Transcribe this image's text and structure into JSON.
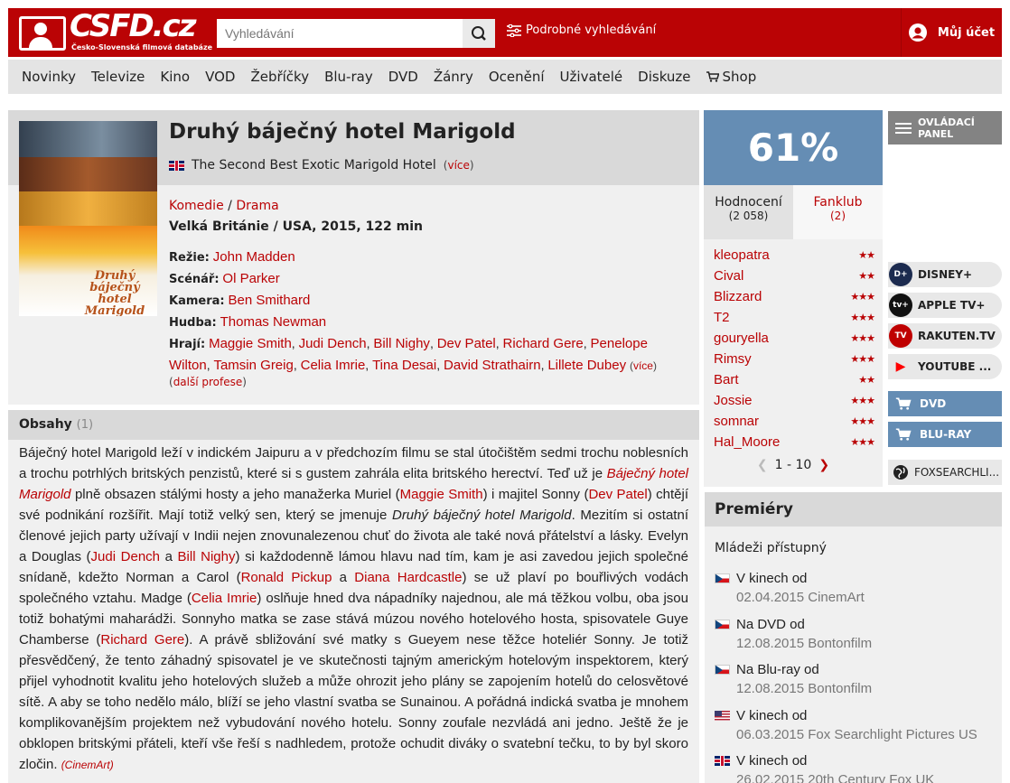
{
  "header": {
    "logo_text": "CSFD.cz",
    "logo_sub": "Česko-Slovenská filmová databáze",
    "search_placeholder": "Vyhledávání",
    "advanced_search": "Podrobné vyhledávání",
    "account": "Můj účet"
  },
  "nav": {
    "items": [
      "Novinky",
      "Televize",
      "Kino",
      "VOD",
      "Žebříčky",
      "Blu-ray",
      "DVD",
      "Žánry",
      "Ocenění",
      "Uživatelé",
      "Diskuze",
      "Shop"
    ]
  },
  "film": {
    "title": "Druhý báječný hotel Marigold",
    "original_title": "The Second Best Exotic Marigold Hotel",
    "more_label": "více",
    "genres": [
      "Komedie",
      "Drama"
    ],
    "origin": "Velká Británie / USA, 2015, 122 min",
    "poster_title": "Druhý báječný hotel Marigold",
    "creators": {
      "directing_label": "Režie:",
      "directing": [
        "John Madden"
      ],
      "writing_label": "Scénář:",
      "writing": [
        "Ol Parker"
      ],
      "camera_label": "Kamera:",
      "camera": [
        "Ben Smithard"
      ],
      "music_label": "Hudba:",
      "music": [
        "Thomas Newman"
      ],
      "cast_label": "Hrají:",
      "cast": [
        "Maggie Smith",
        "Judi Dench",
        "Bill Nighy",
        "Dev Patel",
        "Richard Gere",
        "Penelope Wilton",
        "Tamsin Greig",
        "Celia Imrie",
        "Tina Desai",
        "David Strathairn",
        "Lillete Dubey"
      ]
    },
    "other_professions": "další profese"
  },
  "plot": {
    "title": "Obsahy",
    "count": "(1)",
    "p1": "Báječný hotel Marigold leží v indickém Jaipuru a v předchozím filmu se stal útočištěm sedmi trochu noblesních a trochu potrhlých britských penzistů, které si s gustem zahrála elita britského herectví. Teď už je ",
    "p1_italic_link": "Báječný hotel Marigold",
    "p2": " plně obsazen stálými hosty a jeho manažerka Muriel (",
    "l_maggie": "Maggie Smith",
    "p3": ") i majitel Sonny (",
    "l_dev": "Dev Patel",
    "p4": ") chtějí své podnikání rozšířit. Mají totiž velký sen, který se jmenuje ",
    "p4_italic": "Druhý báječný hotel Marigold",
    "p5": ". Mezitím si ostatní členové jejich party užívají v Indii nejen znovunalezenou chuť do života ale také nová přátelství a lásky. Evelyn a Douglas (",
    "l_judi": "Judi Dench",
    "p6": " a ",
    "l_bill": "Bill Nighy",
    "p7": ") si každodenně lámou hlavu nad tím, kam je asi zavedou jejich společné snídaně, kdežto Norman a Carol (",
    "l_ronald": "Ronald Pickup",
    "p8": " a ",
    "l_diana": "Diana Hardcastle",
    "p9": ") se už plaví po bouřlivých vodách společného vztahu. Madge (",
    "l_celia": "Celia Imrie",
    "p10": ") oslňuje hned dva nápadníky najednou, ale má těžkou volbu, oba jsou totiž bohatými maharádži. Sonnyho matka se zase stává múzou nového hotelového hosta, spisovatele Guye Chamberse (",
    "l_richard": "Richard Gere",
    "p11": "). A právě sbližování své matky s Gueyem nese těžce hoteliér Sonny. Je totiž přesvědčený, že tento záhadný spisovatel je ve skutečnosti tajným americkým hotelovým inspektorem, který přijel vyhodnotit kvalitu jeho hotelových služeb a může ohrozit jeho plány se zapojením hotelů do celosvětové sítě. A aby se toho nedělo málo, blíží se jeho vlastní svatba se Sunainou. A pořádná indická svatba je mnohem komplikovanějším projektem než vybudování nového hotelu. Sonny zoufale nezvládá ani jedno. Ještě že je obklopen britskými přáteli, kteří vše řeší s nadhledem, protože ochudit diváky o svatební tečku, to by byl skoro zločin. ",
    "source": "(CinemArt)"
  },
  "rating": {
    "percent": "61%",
    "tab_rating": "Hodnocení",
    "tab_rating_count": "(2 058)",
    "tab_fanclub": "Fanklub",
    "tab_fanclub_count": "(2)",
    "users": [
      {
        "name": "kleopatra",
        "stars": 2
      },
      {
        "name": "Cival",
        "stars": 2
      },
      {
        "name": "Blizzard",
        "stars": 3
      },
      {
        "name": "T2",
        "stars": 3
      },
      {
        "name": "gouryella",
        "stars": 3
      },
      {
        "name": "Rimsy",
        "stars": 3
      },
      {
        "name": "Bart",
        "stars": 2
      },
      {
        "name": "Jossie",
        "stars": 3
      },
      {
        "name": "somnar",
        "stars": 3
      },
      {
        "name": "Hal_Moore",
        "stars": 3
      }
    ],
    "pager": "1 - 10"
  },
  "side": {
    "panel": [
      "OVLÁDACÍ",
      "PANEL"
    ],
    "vod": [
      {
        "label": "DISNEY+",
        "icon": "disney-plus-icon",
        "color": "#1c2b4f",
        "glyph": "D+"
      },
      {
        "label": "APPLE TV+",
        "icon": "apple-tv-icon",
        "color": "#111111",
        "glyph": "tv+"
      },
      {
        "label": "RAKUTEN.TV",
        "icon": "rakuten-tv-icon",
        "color": "#bf0000",
        "glyph": "TV"
      },
      {
        "label": "YOUTUBE ...",
        "icon": "youtube-icon",
        "color": "#e8e8e8",
        "glyph": "▶"
      }
    ],
    "dvd": "DVD",
    "bluray": "BLU-RAY",
    "fox": "FOXSEARCHLI..."
  },
  "premieres": {
    "title": "Premiéry",
    "age": "Mládeži přístupný",
    "entries": [
      {
        "flag": "cz",
        "label": "V kinech od",
        "detail": "02.04.2015 CinemArt"
      },
      {
        "flag": "cz",
        "label": "Na DVD od",
        "detail": "12.08.2015 Bontonfilm"
      },
      {
        "flag": "cz",
        "label": "Na Blu-ray od",
        "detail": "12.08.2015 Bontonfilm"
      },
      {
        "flag": "us",
        "label": "V kinech od",
        "detail": "06.03.2015 Fox Searchlight Pictures US"
      },
      {
        "flag": "gb",
        "label": "V kinech od",
        "detail": "26.02.2015 20th Century Fox UK"
      }
    ]
  }
}
